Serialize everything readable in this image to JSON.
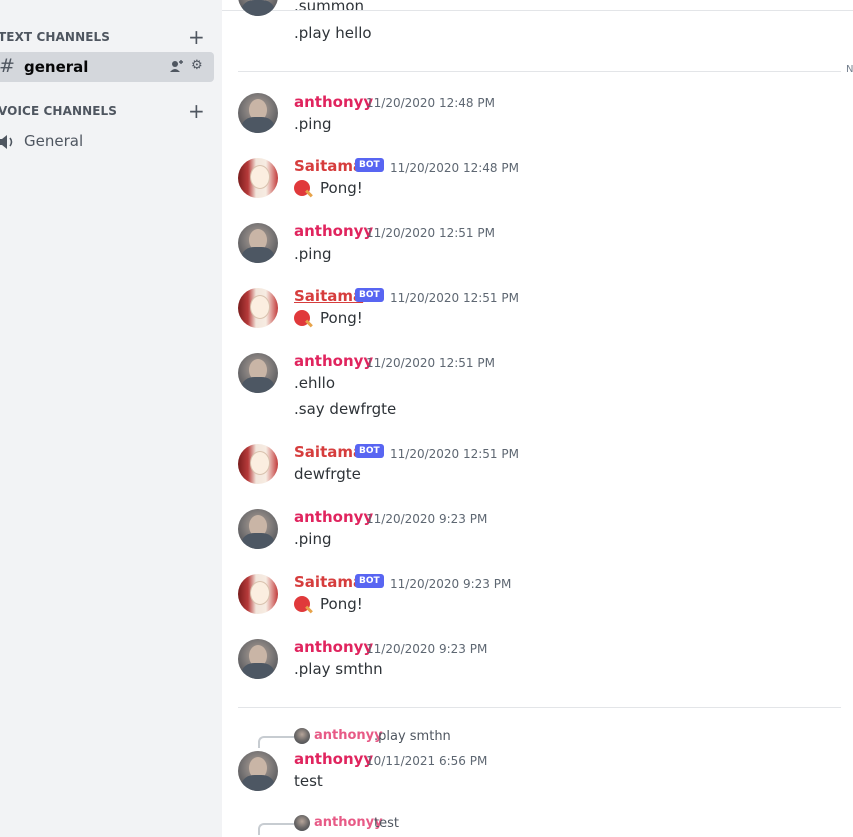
{
  "sidebar": {
    "text_channels_label": "TEXT CHANNELS",
    "voice_channels_label": "VOICE CHANNELS",
    "add_icon": "plus-icon",
    "channels": [
      {
        "name": "general",
        "type": "text",
        "icon": "hash-icon",
        "selected": true
      },
      {
        "name": "General",
        "type": "voice",
        "icon": "speaker-icon",
        "selected": false
      }
    ]
  },
  "chat": {
    "partial_top_text": ".summon",
    "top_message": ".play hello",
    "divider_end_text": "N",
    "messages": [
      {
        "author": "anthonyy",
        "bot": false,
        "time": "11/20/2020 12:48 PM",
        "lines": [
          ".ping"
        ]
      },
      {
        "author": "Saitama",
        "bot": true,
        "bot_tag": "BOT",
        "time": "11/20/2020 12:48 PM",
        "emoji": "ping-pong-emoji",
        "text": "Pong!"
      },
      {
        "author": "anthonyy",
        "bot": false,
        "time": "11/20/2020 12:51 PM",
        "lines": [
          ".ping"
        ]
      },
      {
        "author": "Saitama",
        "bot": true,
        "bot_tag": "BOT",
        "time": "11/20/2020 12:51 PM",
        "emoji": "ping-pong-emoji",
        "text": "Pong!"
      },
      {
        "author": "anthonyy",
        "bot": false,
        "time": "11/20/2020 12:51 PM",
        "lines": [
          ".ehllo",
          ".say dewfrgte"
        ]
      },
      {
        "author": "Saitama",
        "bot": true,
        "bot_tag": "BOT",
        "time": "11/20/2020 12:51 PM",
        "text": "dewfrgte"
      },
      {
        "author": "anthonyy",
        "bot": false,
        "time": "11/20/2020 9:23 PM",
        "lines": [
          ".ping"
        ]
      },
      {
        "author": "Saitama",
        "bot": true,
        "bot_tag": "BOT",
        "time": "11/20/2020 9:23 PM",
        "emoji": "ping-pong-emoji",
        "text": "Pong!"
      },
      {
        "author": "anthonyy",
        "bot": false,
        "time": "11/20/2020 9:23 PM",
        "lines": [
          ".play smthn"
        ]
      }
    ],
    "reply1": {
      "ref_author": "anthonyy",
      "ref_text": ".play smthn",
      "author": "anthonyy",
      "time": "10/11/2021 6:56 PM",
      "text": "test"
    },
    "reply2": {
      "ref_author": "anthonyy",
      "ref_text": "test"
    }
  }
}
